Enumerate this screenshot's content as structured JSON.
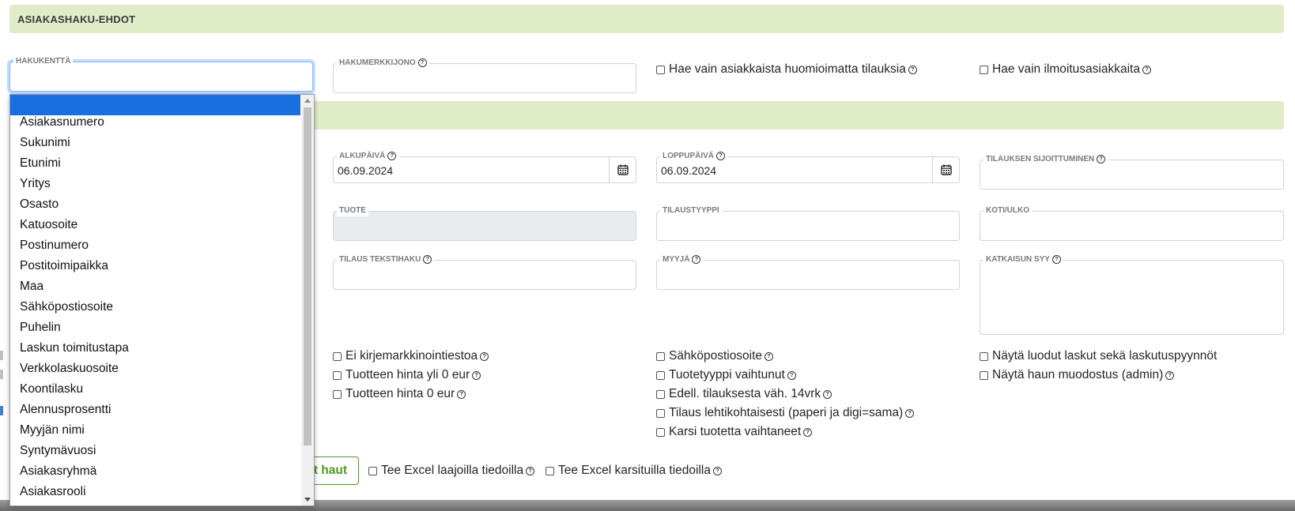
{
  "section1": {
    "title": "ASIAKASHAKU-EHDOT"
  },
  "fields": {
    "hakukentta": {
      "label": "HAKUKENTTÄ",
      "value": ""
    },
    "hakumerkkijono": {
      "label": "HAKUMERKKIJONO",
      "value": ""
    },
    "alkupaiva": {
      "label": "ALKUPÄIVÄ",
      "value": "06.09.2024"
    },
    "loppupaiva": {
      "label": "LOPPUPÄIVÄ",
      "value": "06.09.2024"
    },
    "tilauksen_sijoittuminen": {
      "label": "TILAUKSEN SIJOITTUMINEN",
      "value": ""
    },
    "tuote": {
      "label": "TUOTE",
      "value": ""
    },
    "tilaustyyppi": {
      "label": "TILAUSTYYPPI",
      "value": ""
    },
    "koti_ulko": {
      "label": "KOTI/ULKO",
      "value": ""
    },
    "tilaus_tekstihaku": {
      "label": "TILAUS TEKSTIHAKU",
      "value": ""
    },
    "myyja": {
      "label": "MYYJÄ",
      "value": ""
    },
    "katkaisun_syy": {
      "label": "KATKAISUN SYY",
      "value": ""
    }
  },
  "top_checkboxes": [
    {
      "label": "Hae vain asiakkaista huomioimatta tilauksia",
      "checked": false
    },
    {
      "label": "Hae vain ilmoitusasiakkaita",
      "checked": false
    }
  ],
  "checkboxes_col2": [
    {
      "label": "Ei kirjemarkkinointiestoa",
      "checked": false
    },
    {
      "label": "Tuotteen hinta yli 0 eur",
      "checked": false
    },
    {
      "label": "Tuotteen hinta 0 eur",
      "checked": false
    }
  ],
  "checkboxes_col3": [
    {
      "label": "Sähköpostiosoite",
      "checked": false
    },
    {
      "label": "Tuotetyyppi vaihtunut",
      "checked": false
    },
    {
      "label": "Edell. tilauksesta väh. 14vrk",
      "checked": false
    },
    {
      "label": "Tilaus lehtikohtaisesti (paperi ja digi=sama)",
      "checked": false
    },
    {
      "label": "Karsi tuotetta vaihtaneet",
      "checked": false
    }
  ],
  "checkboxes_col4": [
    {
      "label": "Näytä luodut laskut sekä laskutuspyynnöt",
      "checked": false
    },
    {
      "label": "Näytä haun muodostus (admin)",
      "checked": false
    }
  ],
  "bottom": {
    "button_label": "t haut",
    "excel_checkboxes": [
      {
        "label": "Tee Excel laajoilla tiedoilla",
        "checked": false
      },
      {
        "label": "Tee Excel karsituilla tiedoilla",
        "checked": false
      }
    ]
  },
  "dropdown": {
    "selected": "",
    "options": [
      "",
      "Asiakasnumero",
      "Sukunimi",
      "Etunimi",
      "Yritys",
      "Osasto",
      "Katuosoite",
      "Postinumero",
      "Postitoimipaikka",
      "Maa",
      "Sähköpostiosoite",
      "Puhelin",
      "Laskun toimitustapa",
      "Verkkolaskuosoite",
      "Koontilasku",
      "Alennusprosentti",
      "Myyjän nimi",
      "Syntymävuosi",
      "Asiakasryhmä",
      "Asiakasrooli"
    ]
  },
  "icons": {
    "help": "question-circle-icon",
    "calendar": "calendar-icon"
  },
  "colors": {
    "section_bg": "#e0ecc8",
    "selected_option": "#1a6fe0",
    "button_green": "#4c9a1f"
  }
}
